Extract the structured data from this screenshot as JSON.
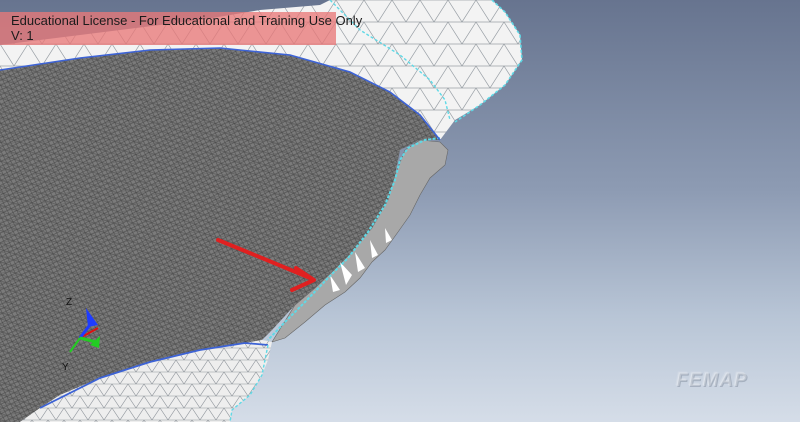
{
  "license": {
    "line1": "Educational License - For Educational and Training Use Only",
    "line2": "V: 1"
  },
  "triad": {
    "z_label": "Z",
    "y_label": "Y"
  },
  "watermark": "FEMAP",
  "colors": {
    "license_bg": "#e87878",
    "mesh_fill": "#7d7d7d",
    "mesh_line": "#444444",
    "shell_fill": "#f2f2f2",
    "edge_cyan": "#5fd9e6",
    "edge_blue": "#3d63d6",
    "arrow_red": "#e02020",
    "axis_z": "#1e3cff",
    "axis_y": "#22cc22",
    "axis_x": "#d11"
  },
  "icons": {
    "triad": "coordinate-triad-icon",
    "annotation": "red-arrow-icon"
  }
}
